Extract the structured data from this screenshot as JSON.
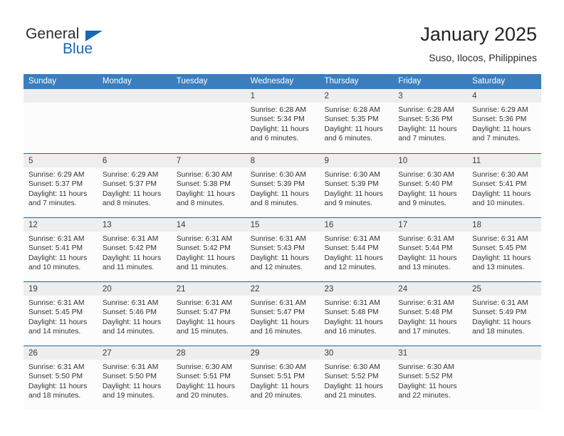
{
  "brand": {
    "word_one": "General",
    "word_two": "Blue",
    "logo_icon": "blue-triangle-icon"
  },
  "header": {
    "title": "January 2025",
    "subtitle": "Suso, Ilocos, Philippines"
  },
  "colors": {
    "header_blue": "#3a7ebf",
    "rule_blue": "#1668b3",
    "brand_blue": "#1668b3",
    "date_band": "#eeeeee",
    "cell_bg": "#fcfcfc"
  },
  "weekdays": [
    "Sunday",
    "Monday",
    "Tuesday",
    "Wednesday",
    "Thursday",
    "Friday",
    "Saturday"
  ],
  "calendar": {
    "month": "January",
    "year": "2025",
    "weeks": [
      [
        {
          "day": "",
          "lines": []
        },
        {
          "day": "",
          "lines": []
        },
        {
          "day": "",
          "lines": []
        },
        {
          "day": "1",
          "lines": [
            "Sunrise: 6:28 AM",
            "Sunset: 5:34 PM",
            "Daylight: 11 hours",
            "and 6 minutes."
          ]
        },
        {
          "day": "2",
          "lines": [
            "Sunrise: 6:28 AM",
            "Sunset: 5:35 PM",
            "Daylight: 11 hours",
            "and 6 minutes."
          ]
        },
        {
          "day": "3",
          "lines": [
            "Sunrise: 6:28 AM",
            "Sunset: 5:36 PM",
            "Daylight: 11 hours",
            "and 7 minutes."
          ]
        },
        {
          "day": "4",
          "lines": [
            "Sunrise: 6:29 AM",
            "Sunset: 5:36 PM",
            "Daylight: 11 hours",
            "and 7 minutes."
          ]
        }
      ],
      [
        {
          "day": "5",
          "lines": [
            "Sunrise: 6:29 AM",
            "Sunset: 5:37 PM",
            "Daylight: 11 hours",
            "and 7 minutes."
          ]
        },
        {
          "day": "6",
          "lines": [
            "Sunrise: 6:29 AM",
            "Sunset: 5:37 PM",
            "Daylight: 11 hours",
            "and 8 minutes."
          ]
        },
        {
          "day": "7",
          "lines": [
            "Sunrise: 6:30 AM",
            "Sunset: 5:38 PM",
            "Daylight: 11 hours",
            "and 8 minutes."
          ]
        },
        {
          "day": "8",
          "lines": [
            "Sunrise: 6:30 AM",
            "Sunset: 5:39 PM",
            "Daylight: 11 hours",
            "and 8 minutes."
          ]
        },
        {
          "day": "9",
          "lines": [
            "Sunrise: 6:30 AM",
            "Sunset: 5:39 PM",
            "Daylight: 11 hours",
            "and 9 minutes."
          ]
        },
        {
          "day": "10",
          "lines": [
            "Sunrise: 6:30 AM",
            "Sunset: 5:40 PM",
            "Daylight: 11 hours",
            "and 9 minutes."
          ]
        },
        {
          "day": "11",
          "lines": [
            "Sunrise: 6:30 AM",
            "Sunset: 5:41 PM",
            "Daylight: 11 hours",
            "and 10 minutes."
          ]
        }
      ],
      [
        {
          "day": "12",
          "lines": [
            "Sunrise: 6:31 AM",
            "Sunset: 5:41 PM",
            "Daylight: 11 hours",
            "and 10 minutes."
          ]
        },
        {
          "day": "13",
          "lines": [
            "Sunrise: 6:31 AM",
            "Sunset: 5:42 PM",
            "Daylight: 11 hours",
            "and 11 minutes."
          ]
        },
        {
          "day": "14",
          "lines": [
            "Sunrise: 6:31 AM",
            "Sunset: 5:42 PM",
            "Daylight: 11 hours",
            "and 11 minutes."
          ]
        },
        {
          "day": "15",
          "lines": [
            "Sunrise: 6:31 AM",
            "Sunset: 5:43 PM",
            "Daylight: 11 hours",
            "and 12 minutes."
          ]
        },
        {
          "day": "16",
          "lines": [
            "Sunrise: 6:31 AM",
            "Sunset: 5:44 PM",
            "Daylight: 11 hours",
            "and 12 minutes."
          ]
        },
        {
          "day": "17",
          "lines": [
            "Sunrise: 6:31 AM",
            "Sunset: 5:44 PM",
            "Daylight: 11 hours",
            "and 13 minutes."
          ]
        },
        {
          "day": "18",
          "lines": [
            "Sunrise: 6:31 AM",
            "Sunset: 5:45 PM",
            "Daylight: 11 hours",
            "and 13 minutes."
          ]
        }
      ],
      [
        {
          "day": "19",
          "lines": [
            "Sunrise: 6:31 AM",
            "Sunset: 5:45 PM",
            "Daylight: 11 hours",
            "and 14 minutes."
          ]
        },
        {
          "day": "20",
          "lines": [
            "Sunrise: 6:31 AM",
            "Sunset: 5:46 PM",
            "Daylight: 11 hours",
            "and 14 minutes."
          ]
        },
        {
          "day": "21",
          "lines": [
            "Sunrise: 6:31 AM",
            "Sunset: 5:47 PM",
            "Daylight: 11 hours",
            "and 15 minutes."
          ]
        },
        {
          "day": "22",
          "lines": [
            "Sunrise: 6:31 AM",
            "Sunset: 5:47 PM",
            "Daylight: 11 hours",
            "and 16 minutes."
          ]
        },
        {
          "day": "23",
          "lines": [
            "Sunrise: 6:31 AM",
            "Sunset: 5:48 PM",
            "Daylight: 11 hours",
            "and 16 minutes."
          ]
        },
        {
          "day": "24",
          "lines": [
            "Sunrise: 6:31 AM",
            "Sunset: 5:48 PM",
            "Daylight: 11 hours",
            "and 17 minutes."
          ]
        },
        {
          "day": "25",
          "lines": [
            "Sunrise: 6:31 AM",
            "Sunset: 5:49 PM",
            "Daylight: 11 hours",
            "and 18 minutes."
          ]
        }
      ],
      [
        {
          "day": "26",
          "lines": [
            "Sunrise: 6:31 AM",
            "Sunset: 5:50 PM",
            "Daylight: 11 hours",
            "and 18 minutes."
          ]
        },
        {
          "day": "27",
          "lines": [
            "Sunrise: 6:31 AM",
            "Sunset: 5:50 PM",
            "Daylight: 11 hours",
            "and 19 minutes."
          ]
        },
        {
          "day": "28",
          "lines": [
            "Sunrise: 6:30 AM",
            "Sunset: 5:51 PM",
            "Daylight: 11 hours",
            "and 20 minutes."
          ]
        },
        {
          "day": "29",
          "lines": [
            "Sunrise: 6:30 AM",
            "Sunset: 5:51 PM",
            "Daylight: 11 hours",
            "and 20 minutes."
          ]
        },
        {
          "day": "30",
          "lines": [
            "Sunrise: 6:30 AM",
            "Sunset: 5:52 PM",
            "Daylight: 11 hours",
            "and 21 minutes."
          ]
        },
        {
          "day": "31",
          "lines": [
            "Sunrise: 6:30 AM",
            "Sunset: 5:52 PM",
            "Daylight: 11 hours",
            "and 22 minutes."
          ]
        },
        {
          "day": "",
          "lines": []
        }
      ]
    ]
  }
}
